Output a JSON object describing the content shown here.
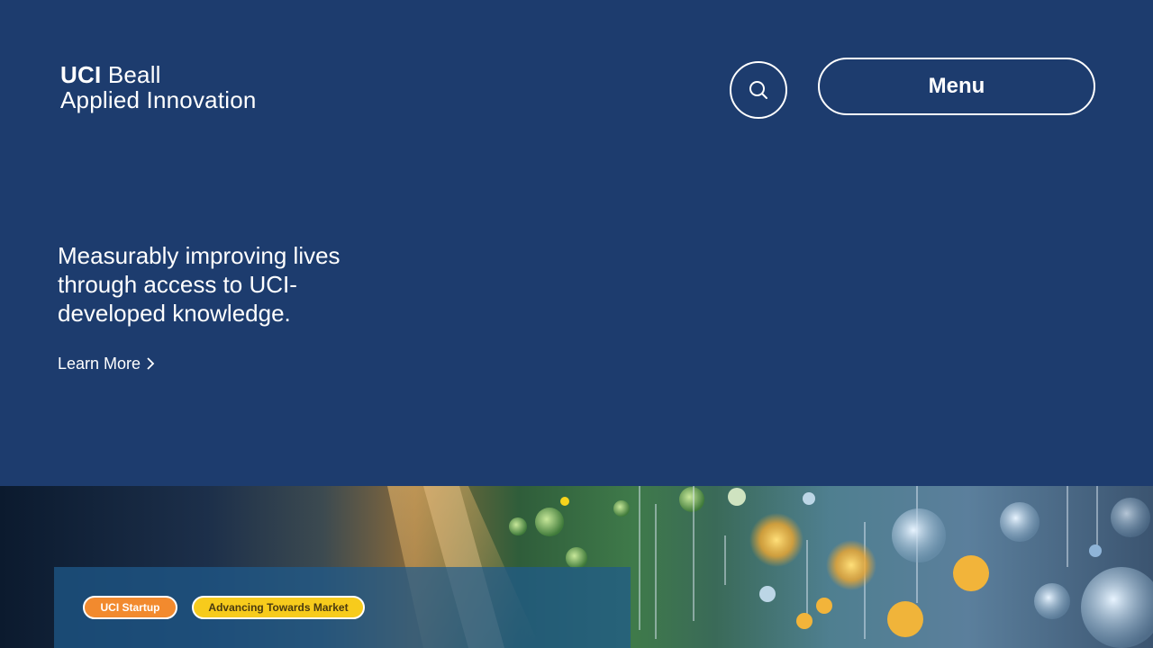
{
  "header": {
    "logo_bold": "UCI",
    "logo_light": "Beall",
    "logo_line2": "Applied Innovation",
    "search_icon": "search-icon",
    "menu_label": "Menu"
  },
  "hero": {
    "headline": "Measurably improving lives through access to UCI-developed knowledge.",
    "cta_label": "Learn More",
    "cta_icon": "chevron-right-icon"
  },
  "feature": {
    "tags": [
      "UCI Startup",
      "Advancing Towards Market"
    ]
  },
  "colors": {
    "background": "#1d3c6e",
    "tag_startup": "#f28a2e",
    "tag_market": "#f7cb1c"
  }
}
